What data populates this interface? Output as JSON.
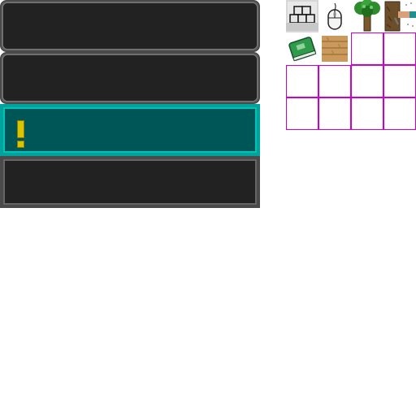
{
  "sheet": {
    "panels": [
      {
        "id": "panel-1",
        "style": "rounded",
        "state": "normal"
      },
      {
        "id": "panel-2",
        "style": "rounded",
        "state": "normal"
      },
      {
        "id": "panel-3",
        "style": "square",
        "state": "active",
        "indicator": "exclamation"
      },
      {
        "id": "panel-4",
        "style": "square",
        "state": "normal"
      }
    ],
    "icons": [
      {
        "name": "stone-brick-icon"
      },
      {
        "name": "mouse-icon"
      },
      {
        "name": "tree-icon"
      },
      {
        "name": "tree-chop-icon"
      },
      {
        "name": "book-icon"
      },
      {
        "name": "wood-plank-icon"
      }
    ],
    "empty_slots": 10
  },
  "colors": {
    "panel_dark": "#222222",
    "panel_border": "#4a4a4a",
    "active_fill": "#005557",
    "active_border": "#00a39b",
    "indicator": "#d8c400",
    "slot_outline": "#cc00cc"
  }
}
